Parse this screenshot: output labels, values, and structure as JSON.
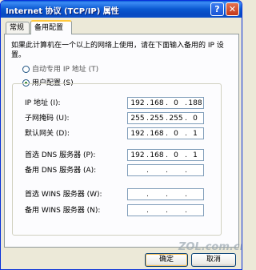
{
  "window": {
    "title": "Internet 协议 (TCP/IP) 属性",
    "help_glyph": "?",
    "close_glyph": "✕"
  },
  "tabs": [
    {
      "label": "常规",
      "selected": false
    },
    {
      "label": "备用配置",
      "selected": true
    }
  ],
  "description": "如果此计算机在一个以上的网络上使用，请在下面输入备用的 IP 设置。",
  "radios": [
    {
      "label": "自动专用 IP 地址 (T)",
      "checked": false
    },
    {
      "label": "用户配置 (S)",
      "checked": true
    }
  ],
  "fields": [
    {
      "label": "IP 地址 (I):",
      "value": [
        "192",
        "168",
        "0",
        "188"
      ]
    },
    {
      "label": "子网掩码 (U):",
      "value": [
        "255",
        "255",
        "255",
        "0"
      ]
    },
    {
      "label": "默认网关 (D):",
      "value": [
        "192",
        "168",
        "0",
        "1"
      ]
    },
    {
      "label": "首选 DNS 服务器 (P):",
      "value": [
        "192",
        "168",
        "0",
        "1"
      ]
    },
    {
      "label": "备用 DNS 服务器 (A):",
      "value": [
        "",
        "",
        "",
        ""
      ]
    },
    {
      "label": "首选 WINS 服务器 (W):",
      "value": [
        "",
        "",
        "",
        ""
      ]
    },
    {
      "label": "备用 WINS 服务器 (N):",
      "value": [
        "",
        "",
        "",
        ""
      ]
    }
  ],
  "separator": ".",
  "buttons": {
    "ok": "确定",
    "cancel": "取消"
  },
  "watermark": "ZOL.com.cn"
}
